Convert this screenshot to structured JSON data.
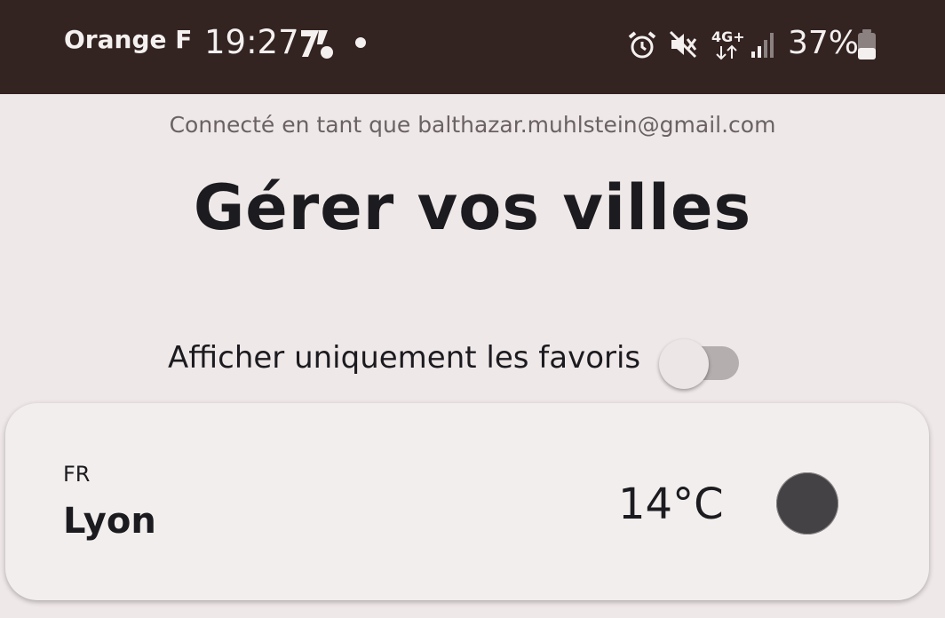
{
  "statusbar": {
    "carrier": "Orange F",
    "time": "19:27",
    "network": "4G+",
    "battery": "37%",
    "icons": [
      "app-logo-icon",
      "dot-icon",
      "alarm-icon",
      "vibrate-icon",
      "network-4g-icon",
      "signal-icon",
      "battery-icon"
    ]
  },
  "header": {
    "connected_as": "Connecté en tant que balthazar.muhlstein@gmail.com",
    "title": "Gérer vos villes"
  },
  "filter": {
    "label": "Afficher uniquement les favoris",
    "enabled": false
  },
  "cities": [
    {
      "country": "FR",
      "name": "Lyon",
      "temperature": "14°C",
      "weather_icon": "weather-dot-icon"
    }
  ],
  "colors": {
    "status_bar": "#332321",
    "background": "#efe8e8",
    "card": "#f2eeed",
    "text": "#1c1b1f"
  }
}
